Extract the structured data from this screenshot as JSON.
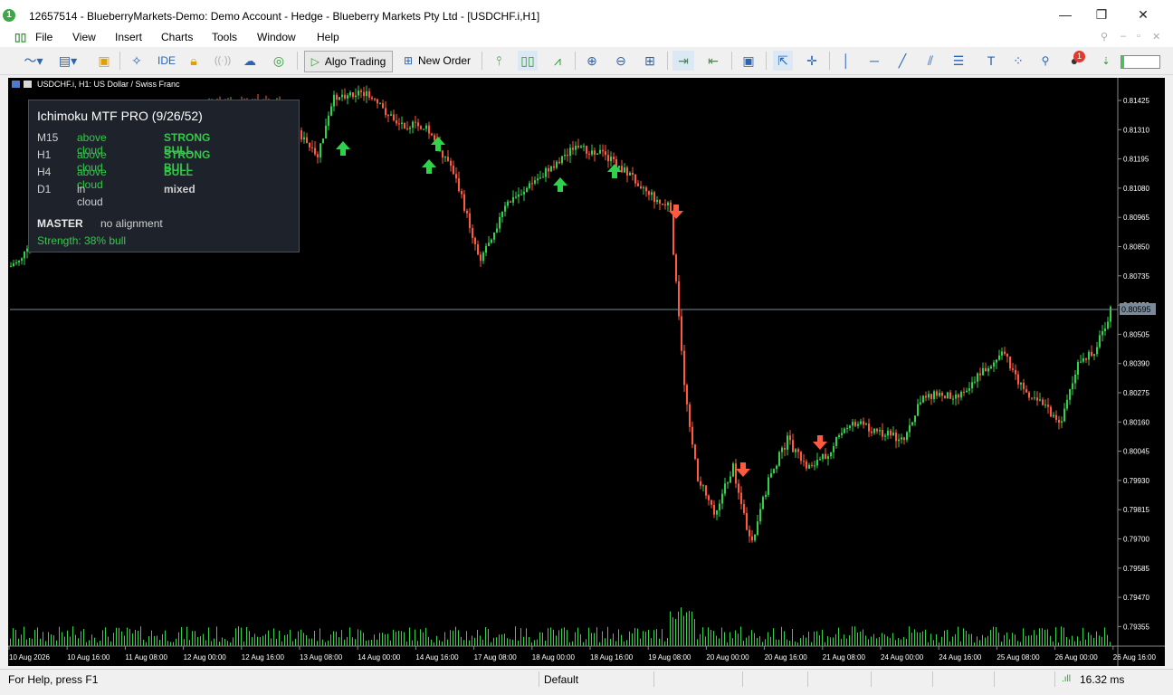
{
  "window": {
    "badge": "1",
    "title": "12657514 - BlueberryMarkets-Demo: Demo Account - Hedge - Blueberry Markets Pty Ltd - [USDCHF.i,H1]",
    "minimize_glyph": "—",
    "maximize_glyph": "❐",
    "close_glyph": "✕"
  },
  "menu": {
    "items": [
      "File",
      "View",
      "Insert",
      "Charts",
      "Tools",
      "Window",
      "Help"
    ]
  },
  "toolbar": {
    "ide_label": "IDE",
    "algo_trading_label": "Algo Trading",
    "new_order_label": "New Order",
    "notification_count": "1"
  },
  "chart": {
    "symbol_label": "USDCHF.i, H1:  US Dollar / Swiss Franc",
    "current_price": "0.80595",
    "price_levels": [
      "0.81425",
      "0.81310",
      "0.81195",
      "0.81080",
      "0.80965",
      "0.80850",
      "0.80735",
      "0.80620",
      "0.80505",
      "0.80390",
      "0.80275",
      "0.80160",
      "0.80045",
      "0.79930",
      "0.79815",
      "0.79700",
      "0.79585",
      "0.79470",
      "0.79355"
    ],
    "time_labels": [
      "10 Aug 2026",
      "10 Aug 16:00",
      "11 Aug 08:00",
      "12 Aug 00:00",
      "12 Aug 16:00",
      "13 Aug 08:00",
      "14 Aug 00:00",
      "14 Aug 16:00",
      "17 Aug 08:00",
      "18 Aug 00:00",
      "18 Aug 16:00",
      "19 Aug 08:00",
      "20 Aug 00:00",
      "20 Aug 16:00",
      "21 Aug 08:00",
      "24 Aug 00:00",
      "24 Aug 16:00",
      "25 Aug 08:00",
      "26 Aug 00:00",
      "26 Aug 16:00"
    ],
    "up_color": "#2fd24a",
    "down_color": "#ff5a40",
    "volume_color": "#2fd24a"
  },
  "indicator": {
    "title": "Ichimoku MTF PRO (9/26/52)",
    "rows": [
      {
        "tf": "M15",
        "status": "above cloud",
        "signal": "STRONG BULL",
        "status_color": "#35c94a",
        "signal_color": "#35c94a"
      },
      {
        "tf": "H1",
        "status": "above cloud",
        "signal": "STRONG BULL",
        "status_color": "#35c94a",
        "signal_color": "#35c94a"
      },
      {
        "tf": "H4",
        "status": "above cloud",
        "signal": "BULL",
        "status_color": "#35c94a",
        "signal_color": "#35c94a"
      },
      {
        "tf": "D1",
        "status": "in cloud",
        "signal": "mixed",
        "status_color": "#d0d0d0",
        "signal_color": "#d0d0d0"
      }
    ],
    "master_label": "MASTER",
    "master_value": "no alignment",
    "strength": "Strength: 38% bull"
  },
  "status_bar": {
    "help": "For Help, press F1",
    "profile": "Default",
    "ping": "16.32 ms"
  }
}
